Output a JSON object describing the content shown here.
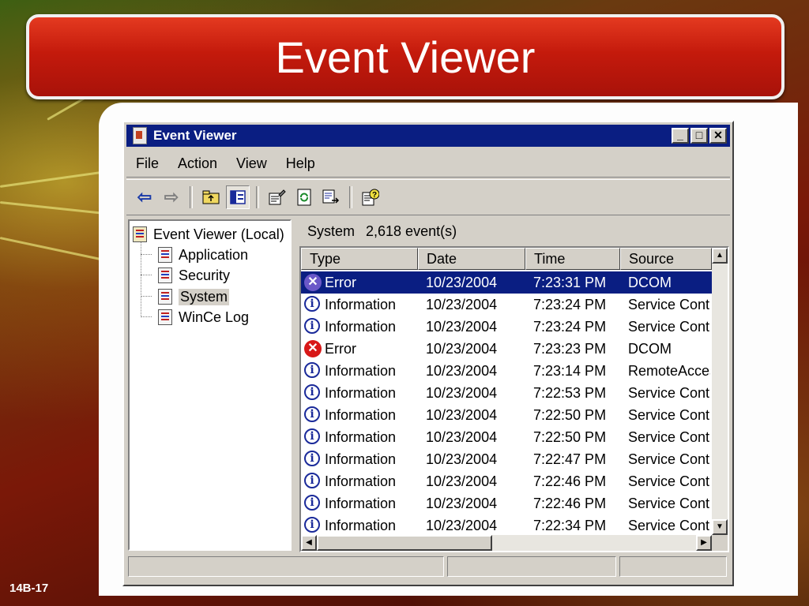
{
  "slide": {
    "title": "Event Viewer",
    "number": "14B-17"
  },
  "window": {
    "title": "Event Viewer",
    "buttons": {
      "minimize": "_",
      "maximize": "□",
      "close": "✕"
    }
  },
  "menu": [
    "File",
    "Action",
    "View",
    "Help"
  ],
  "tree": {
    "root": "Event Viewer (Local)",
    "items": [
      "Application",
      "Security",
      "System",
      "WinCe Log"
    ],
    "selected": "System"
  },
  "list": {
    "log_name": "System",
    "event_count": "2,618 event(s)",
    "columns": [
      "Type",
      "Date",
      "Time",
      "Source"
    ],
    "rows": [
      {
        "type": "Error",
        "date": "10/23/2004",
        "time": "7:23:31 PM",
        "source": "DCOM"
      },
      {
        "type": "Information",
        "date": "10/23/2004",
        "time": "7:23:24 PM",
        "source": "Service Control Manager"
      },
      {
        "type": "Information",
        "date": "10/23/2004",
        "time": "7:23:24 PM",
        "source": "Service Control Manager"
      },
      {
        "type": "Error",
        "date": "10/23/2004",
        "time": "7:23:23 PM",
        "source": "DCOM"
      },
      {
        "type": "Information",
        "date": "10/23/2004",
        "time": "7:23:14 PM",
        "source": "RemoteAccess"
      },
      {
        "type": "Information",
        "date": "10/23/2004",
        "time": "7:22:53 PM",
        "source": "Service Control Manager"
      },
      {
        "type": "Information",
        "date": "10/23/2004",
        "time": "7:22:50 PM",
        "source": "Service Control Manager"
      },
      {
        "type": "Information",
        "date": "10/23/2004",
        "time": "7:22:50 PM",
        "source": "Service Control Manager"
      },
      {
        "type": "Information",
        "date": "10/23/2004",
        "time": "7:22:47 PM",
        "source": "Service Control Manager"
      },
      {
        "type": "Information",
        "date": "10/23/2004",
        "time": "7:22:46 PM",
        "source": "Service Control Manager"
      },
      {
        "type": "Information",
        "date": "10/23/2004",
        "time": "7:22:46 PM",
        "source": "Service Control Manager"
      },
      {
        "type": "Information",
        "date": "10/23/2004",
        "time": "7:22:34 PM",
        "source": "Service Control Manager"
      }
    ]
  },
  "icons": {
    "toolbar": [
      "back-arrow-icon",
      "forward-arrow-icon",
      "up-folder-icon",
      "show-hide-tree-icon",
      "properties-icon",
      "refresh-icon",
      "export-list-icon",
      "help-icon"
    ],
    "event_error": "error-icon",
    "event_info": "information-icon"
  },
  "colors": {
    "titlebar": "#0a1e82",
    "selection": "#0a1e82",
    "banner": "#c41a0c",
    "error": "#d81818",
    "info": "#1a2a9a"
  }
}
